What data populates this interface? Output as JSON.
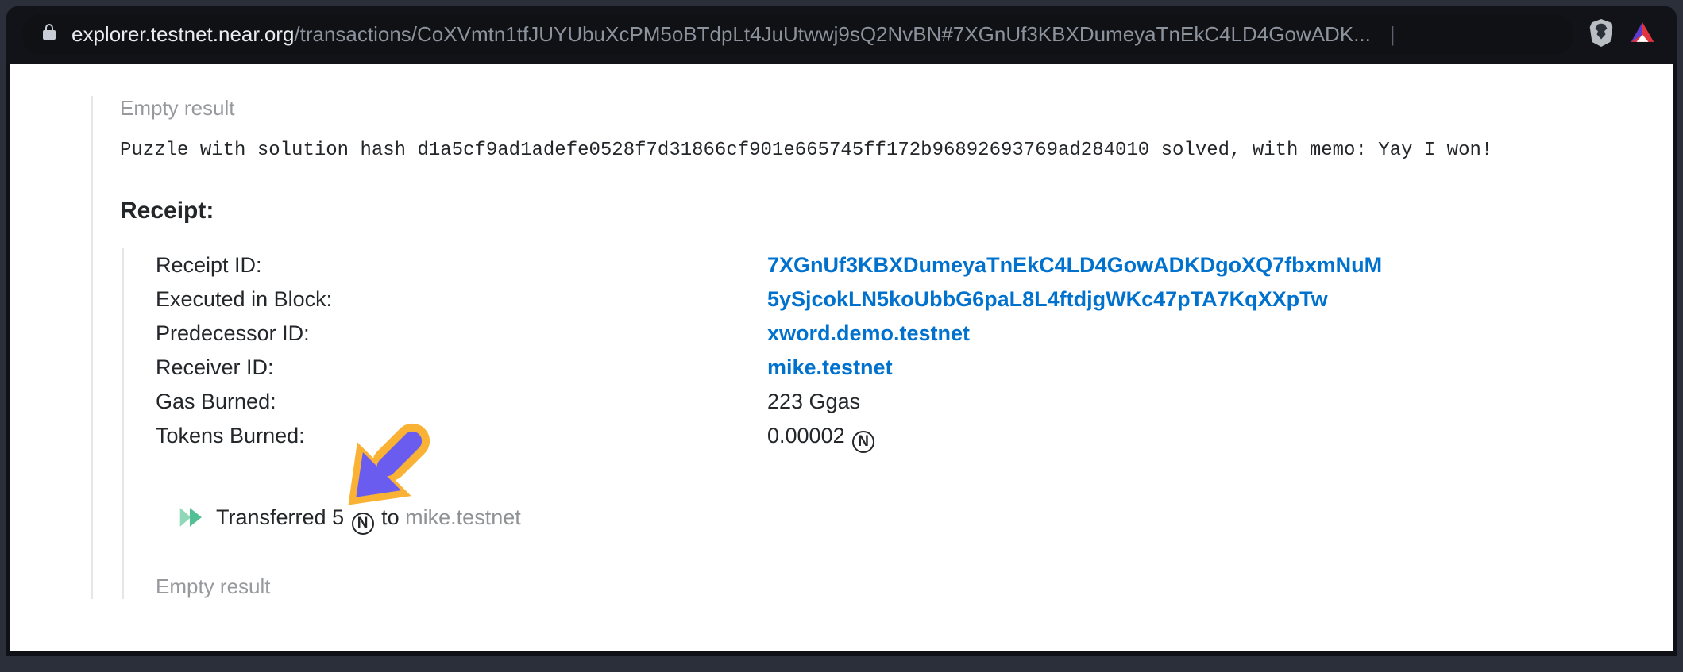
{
  "url": {
    "domain": "explorer.testnet.near.org",
    "path_prefix": "/transactions/CoXVmtn1tfJUYUbuXcPM5oBTdpLt4JuUtwwj9sQ2NvBN#7XGnUf3KBXDumeyaTnEkC4LD4GowADK",
    "ellipsis": "..."
  },
  "page": {
    "empty_result_top": "Empty result",
    "log_line": "Puzzle with solution hash d1a5cf9ad1adefe0528f7d31866cf901e665745ff172b96892693769ad284010 solved, with memo: Yay I won!",
    "receipt_heading": "Receipt:",
    "rows": {
      "receipt_id_label": "Receipt ID:",
      "receipt_id_value": "7XGnUf3KBXDumeyaTnEkC4LD4GowADKDgoXQ7fbxmNuM",
      "block_label": "Executed in Block:",
      "block_value": "5ySjcokLN5koUbbG6paL8L4ftdjgWKc47pTA7KqXXpTw",
      "pred_label": "Predecessor ID:",
      "pred_value": "xword.demo.testnet",
      "recv_label": "Receiver ID:",
      "recv_value": "mike.testnet",
      "gas_label": "Gas Burned:",
      "gas_value": "223 Ggas",
      "tokens_label": "Tokens Burned:",
      "tokens_value": "0.00002"
    },
    "transfer": {
      "prefix": "Transferred",
      "amount": "5",
      "to_word": "to",
      "account": "mike.testnet"
    },
    "near_glyph": "N",
    "empty_result_bottom": "Empty result"
  }
}
